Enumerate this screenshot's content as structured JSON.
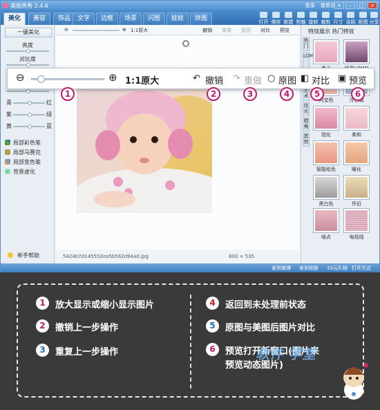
{
  "app": {
    "title": "美图秀秀 2.4.6",
    "title_links": [
      "登录",
      "提意见"
    ],
    "tabs": [
      "美化",
      "美容",
      "饰品",
      "文字",
      "边框",
      "场景",
      "闪图",
      "娃娃",
      "拼图"
    ],
    "tools": [
      "打开",
      "保存",
      "新建",
      "剪裁",
      "旋转",
      "裁剪",
      "尺寸",
      "涂鸦",
      "抠图",
      "分享"
    ],
    "left_panel": {
      "one_key": "一键美化",
      "brightness": "亮度",
      "contrast": "对比度",
      "color_rows": [
        {
          "left": "青",
          "right": "红"
        },
        {
          "left": "紫",
          "right": "绿"
        },
        {
          "left": "黄",
          "right": "蓝"
        }
      ],
      "pens": [
        "局部彩色笔",
        "局部马赛克",
        "局部变色笔",
        "背景虚化"
      ],
      "help": "新手帮助"
    },
    "toolbar_small": {
      "zoom_label": "1:1原大",
      "undo": "撤销",
      "redo": "重做",
      "original": "原图",
      "compare": "对比",
      "preview": "预览"
    },
    "filename": "5424b7d145552ea5b562d94a0.jpg",
    "dimensions": "800 × 535",
    "right_panel": {
      "header": "特效展示  热门特效",
      "vtabs": [
        "热门",
        "LOMO",
        "时尚",
        "艺术",
        "炫光",
        "暗角",
        "其他"
      ],
      "effects": [
        "柔光",
        "经典LOMO",
        "阿宝色",
        "冷色调",
        "锐化",
        "柔和",
        "智能绘色",
        "暖化",
        "黑白色",
        "怀旧",
        "噪点",
        "电视线"
      ]
    },
    "status": [
      "发到微博",
      "发到相册",
      "33元礼物",
      "打开方式"
    ]
  },
  "zoombar": {
    "zoom_label": "1:1原大",
    "undo": "撤销",
    "redo": "重做",
    "original": "原图",
    "compare": "对比",
    "preview": "预览",
    "markers": [
      "1",
      "2",
      "3",
      "4",
      "5",
      "6"
    ]
  },
  "instructions": [
    {
      "num": "1",
      "text": "放大显示或缩小显示图片",
      "color": "#ffffff"
    },
    {
      "num": "2",
      "text": "撤销上一步操作",
      "color": "#c2186e"
    },
    {
      "num": "3",
      "text": "重复上一步操作",
      "color": "#1c6fb5"
    },
    {
      "num": "4",
      "text": "返回到未处理前状态",
      "color": "#c0222a"
    },
    {
      "num": "5",
      "text": "原图与美图后图片对比",
      "color": "#1c6fb5"
    },
    {
      "num": "6",
      "text": "预览打开新窗口(图片来",
      "text2": "预览动态图片)",
      "color": "#c2186e"
    }
  ],
  "watermark": "软件 学堂"
}
